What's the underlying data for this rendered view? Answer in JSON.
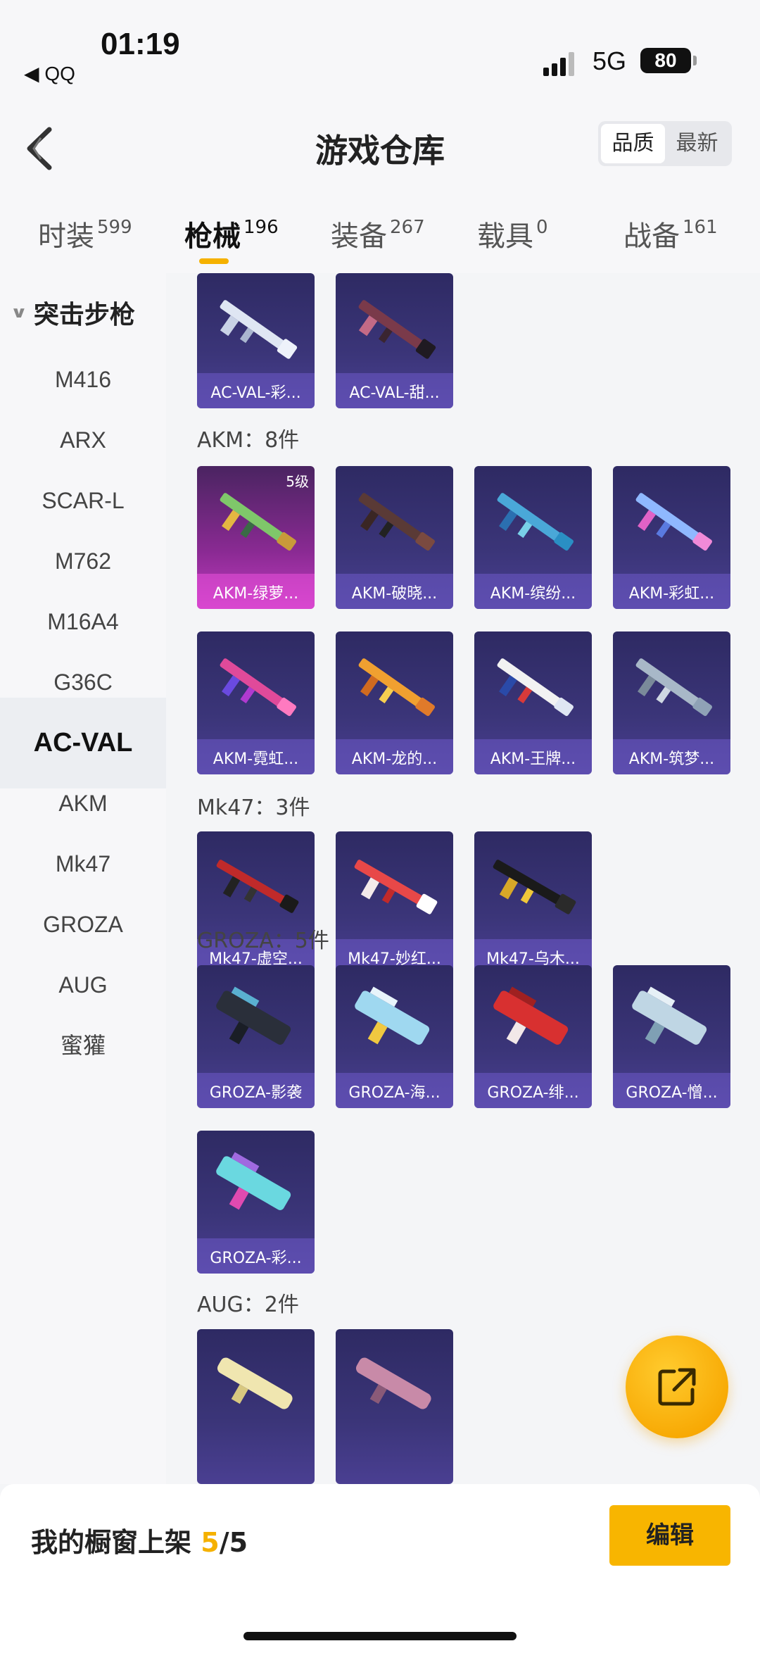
{
  "status": {
    "time": "01:19",
    "back_app": "◀ QQ",
    "network": "5G",
    "battery": "80"
  },
  "header": {
    "title": "游戏仓库",
    "sort_quality": "品质",
    "sort_newest": "最新"
  },
  "tabs": [
    {
      "label": "时装",
      "count": "599"
    },
    {
      "label": "枪械",
      "count": "196"
    },
    {
      "label": "装备",
      "count": "267"
    },
    {
      "label": "载具",
      "count": "0"
    },
    {
      "label": "战备",
      "count": "161"
    }
  ],
  "sidebar": {
    "heading": "突击步枪",
    "items": [
      "M416",
      "ARX",
      "SCAR-L",
      "M762",
      "M16A4",
      "G36C",
      "AC-VAL",
      "AKM",
      "Mk47",
      "GROZA",
      "AUG",
      "蜜獾"
    ]
  },
  "groups": {
    "acval": {
      "cards": [
        "AC-VAL-彩...",
        "AC-VAL-甜..."
      ]
    },
    "akm": {
      "label": "AKM：8件",
      "cards": [
        "AKM-绿萝...",
        "AKM-破晓...",
        "AKM-缤纷...",
        "AKM-彩虹...",
        "AKM-霓虹...",
        "AKM-龙的...",
        "AKM-王牌...",
        "AKM-筑梦..."
      ],
      "level": "5级"
    },
    "mk47": {
      "label": "Mk47：3件",
      "cards": [
        "Mk47-虚空...",
        "Mk47-妙红...",
        "Mk47-乌木..."
      ]
    },
    "groza": {
      "label": "GROZA：5件",
      "cards": [
        "GROZA-影袭",
        "GROZA-海...",
        "GROZA-绯...",
        "GROZA-憎...",
        "GROZA-彩..."
      ]
    },
    "aug": {
      "label": "AUG：2件"
    }
  },
  "bottom": {
    "shelf_label": "我的橱窗上架 ",
    "shelf_count": "5",
    "shelf_total": "/5",
    "edit": "编辑"
  },
  "colors": {
    "accent": "#f5b100",
    "card_bg": "#3b3579",
    "card_pink": "#c23cc0"
  },
  "icons": [
    "back-arrow-icon",
    "share-external-icon",
    "chevron-down-icon",
    "signal-icon",
    "battery-icon"
  ]
}
